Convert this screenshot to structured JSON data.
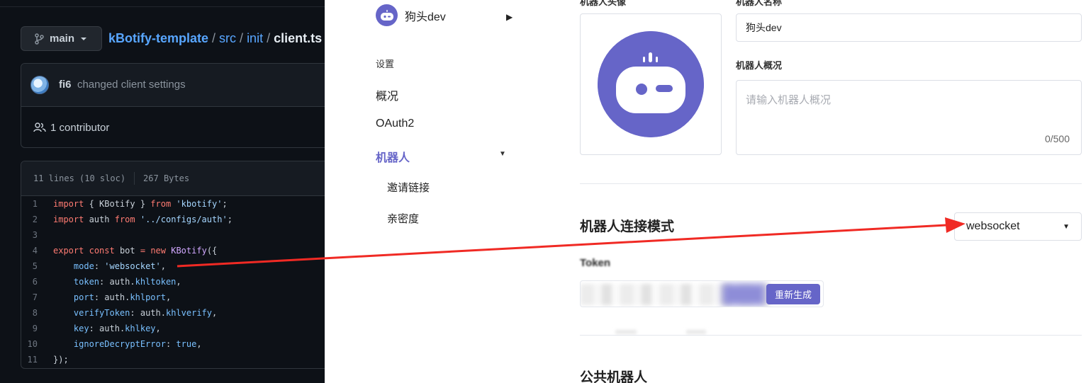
{
  "github": {
    "branch": "main",
    "breadcrumb": {
      "repo": "kBotify-template",
      "dir1": "src",
      "dir2": "init",
      "file": "client.ts",
      "sep": "/"
    },
    "commit": {
      "user": "fi6",
      "message": "changed client settings"
    },
    "contributors": "1 contributor",
    "file_info": {
      "lines": "11 lines (10 sloc)",
      "size": "267 Bytes"
    },
    "code_lines": [
      {
        "n": "1",
        "segments": [
          [
            "kw",
            "import"
          ],
          [
            "t",
            " { KBotify } "
          ],
          [
            "kw",
            "from"
          ],
          [
            "t",
            " "
          ],
          [
            "str",
            "'kbotify'"
          ],
          [
            "t",
            ";"
          ]
        ]
      },
      {
        "n": "2",
        "segments": [
          [
            "kw",
            "import"
          ],
          [
            "t",
            " auth "
          ],
          [
            "kw",
            "from"
          ],
          [
            "t",
            " "
          ],
          [
            "str",
            "'../configs/auth'"
          ],
          [
            "t",
            ";"
          ]
        ]
      },
      {
        "n": "3",
        "segments": []
      },
      {
        "n": "4",
        "segments": [
          [
            "kw",
            "export"
          ],
          [
            "t",
            " "
          ],
          [
            "kw",
            "const"
          ],
          [
            "t",
            " bot "
          ],
          [
            "kw",
            "="
          ],
          [
            "t",
            " "
          ],
          [
            "kw",
            "new"
          ],
          [
            "t",
            " "
          ],
          [
            "fn",
            "KBotify"
          ],
          [
            "t",
            "({"
          ]
        ]
      },
      {
        "n": "5",
        "segments": [
          [
            "t",
            "    "
          ],
          [
            "prop",
            "mode"
          ],
          [
            "t",
            ": "
          ],
          [
            "str",
            "'websocket'"
          ],
          [
            "t",
            ","
          ]
        ]
      },
      {
        "n": "6",
        "segments": [
          [
            "t",
            "    "
          ],
          [
            "prop",
            "token"
          ],
          [
            "t",
            ": auth."
          ],
          [
            "prop",
            "khltoken"
          ],
          [
            "t",
            ","
          ]
        ]
      },
      {
        "n": "7",
        "segments": [
          [
            "t",
            "    "
          ],
          [
            "prop",
            "port"
          ],
          [
            "t",
            ": auth."
          ],
          [
            "prop",
            "khlport"
          ],
          [
            "t",
            ","
          ]
        ]
      },
      {
        "n": "8",
        "segments": [
          [
            "t",
            "    "
          ],
          [
            "prop",
            "verifyToken"
          ],
          [
            "t",
            ": auth."
          ],
          [
            "prop",
            "khlverify"
          ],
          [
            "t",
            ","
          ]
        ]
      },
      {
        "n": "9",
        "segments": [
          [
            "t",
            "    "
          ],
          [
            "prop",
            "key"
          ],
          [
            "t",
            ": auth."
          ],
          [
            "prop",
            "khlkey"
          ],
          [
            "t",
            ","
          ]
        ]
      },
      {
        "n": "10",
        "segments": [
          [
            "t",
            "    "
          ],
          [
            "prop",
            "ignoreDecryptError"
          ],
          [
            "t",
            ": "
          ],
          [
            "prop",
            "true"
          ],
          [
            "t",
            ","
          ]
        ]
      },
      {
        "n": "11",
        "segments": [
          [
            "t",
            "});"
          ]
        ]
      }
    ]
  },
  "nav": {
    "bot_name": "狗头dev",
    "section_label": "设置",
    "items": [
      "概况",
      "OAuth2",
      "机器人"
    ],
    "sub_items": [
      "邀请链接",
      "亲密度"
    ]
  },
  "settings": {
    "cut_label_left": "机器人头像",
    "cut_label_right": "机器人名称",
    "name_value": "狗头dev",
    "desc_label": "机器人概况",
    "desc_placeholder": "请输入机器人概况",
    "desc_count": "0/500",
    "mode_title": "机器人连接模式",
    "mode_value": "websocket",
    "token_label": "Token",
    "regen_button": "重新生成",
    "public_title": "公共机器人"
  },
  "colors": {
    "accent": "#6665c8",
    "github_bg": "#0d1117",
    "link_blue": "#58a6ff",
    "arrow_red": "#f02a24"
  }
}
